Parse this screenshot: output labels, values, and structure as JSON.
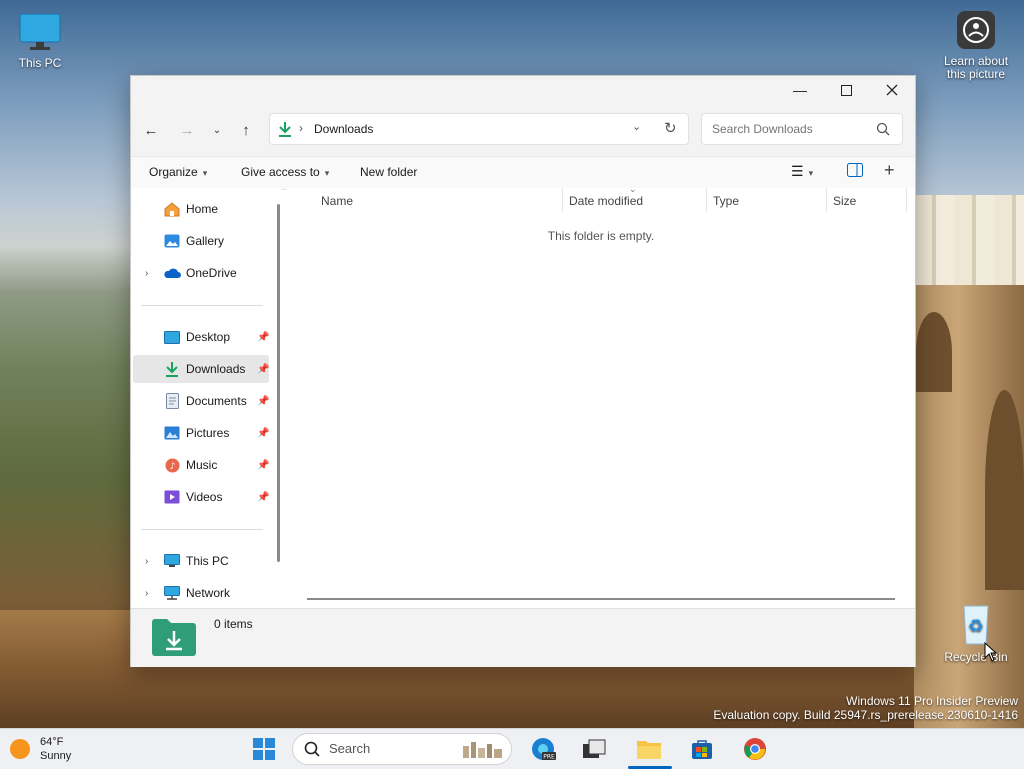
{
  "desktop": {
    "icons": [
      {
        "label": "This PC"
      },
      {
        "label_line1": "Learn about",
        "label_line2": "this picture"
      },
      {
        "label": "Recycle Bin"
      }
    ],
    "watermark_line1": "Windows 11 Pro Insider Preview",
    "watermark_line2": "Evaluation copy. Build 25947.rs_prerelease.230610-1416"
  },
  "window": {
    "address": {
      "location": "Downloads"
    },
    "search": {
      "placeholder": "Search Downloads"
    },
    "commands": {
      "organize": "Organize",
      "give_access": "Give access to",
      "new_folder": "New folder"
    },
    "sidebar": {
      "items": [
        {
          "label": "Home"
        },
        {
          "label": "Gallery"
        },
        {
          "label": "OneDrive"
        },
        {
          "label": "Desktop"
        },
        {
          "label": "Downloads"
        },
        {
          "label": "Documents"
        },
        {
          "label": "Pictures"
        },
        {
          "label": "Music"
        },
        {
          "label": "Videos"
        },
        {
          "label": "This PC"
        },
        {
          "label": "Network"
        }
      ]
    },
    "columns": [
      "Name",
      "Date modified",
      "Type",
      "Size"
    ],
    "empty_message": "This folder is empty.",
    "status": {
      "item_count": "0 items"
    }
  },
  "taskbar": {
    "weather": {
      "temp": "64°F",
      "condition": "Sunny"
    },
    "search_placeholder": "Search"
  },
  "colors": {
    "accent": "#0067c0",
    "downloads_green": "#1aa260",
    "folder_teal": "#2f9e78"
  }
}
